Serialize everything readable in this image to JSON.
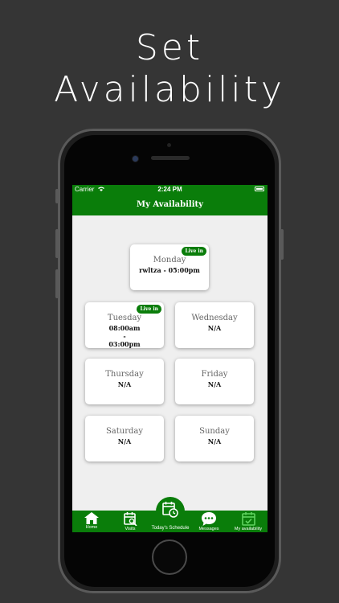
{
  "headline": {
    "line1": "Set",
    "line2": "Availability"
  },
  "status_bar": {
    "carrier": "Carrier",
    "time": "2:24 PM"
  },
  "nav": {
    "title": "My Availability"
  },
  "badge_text": "Live in",
  "days": [
    {
      "day": "Monday",
      "hours": "rwltza - 05:00pm",
      "live_in": true
    },
    {
      "day": "Tuesday",
      "hours": "08:00am - 03:00pm",
      "live_in": true
    },
    {
      "day": "Wednesday",
      "hours": "N/A",
      "live_in": false
    },
    {
      "day": "Thursday",
      "hours": "N/A",
      "live_in": false
    },
    {
      "day": "Friday",
      "hours": "N/A",
      "live_in": false
    },
    {
      "day": "Saturday",
      "hours": "N/A",
      "live_in": false
    },
    {
      "day": "Sunday",
      "hours": "N/A",
      "live_in": false
    }
  ],
  "tabs": [
    {
      "label": "Home",
      "icon": "home-icon"
    },
    {
      "label": "Visits",
      "icon": "calendar-search-icon"
    },
    {
      "label": "Today's Schedule",
      "icon": "calendar-clock-icon"
    },
    {
      "label": "Messages",
      "icon": "chat-icon"
    },
    {
      "label": "My availability",
      "icon": "calendar-check-icon"
    }
  ],
  "colors": {
    "background": "#353535",
    "brand_green": "#0a7d0a",
    "active_tab": "#5fd35f",
    "screen_bg": "#efefef"
  }
}
